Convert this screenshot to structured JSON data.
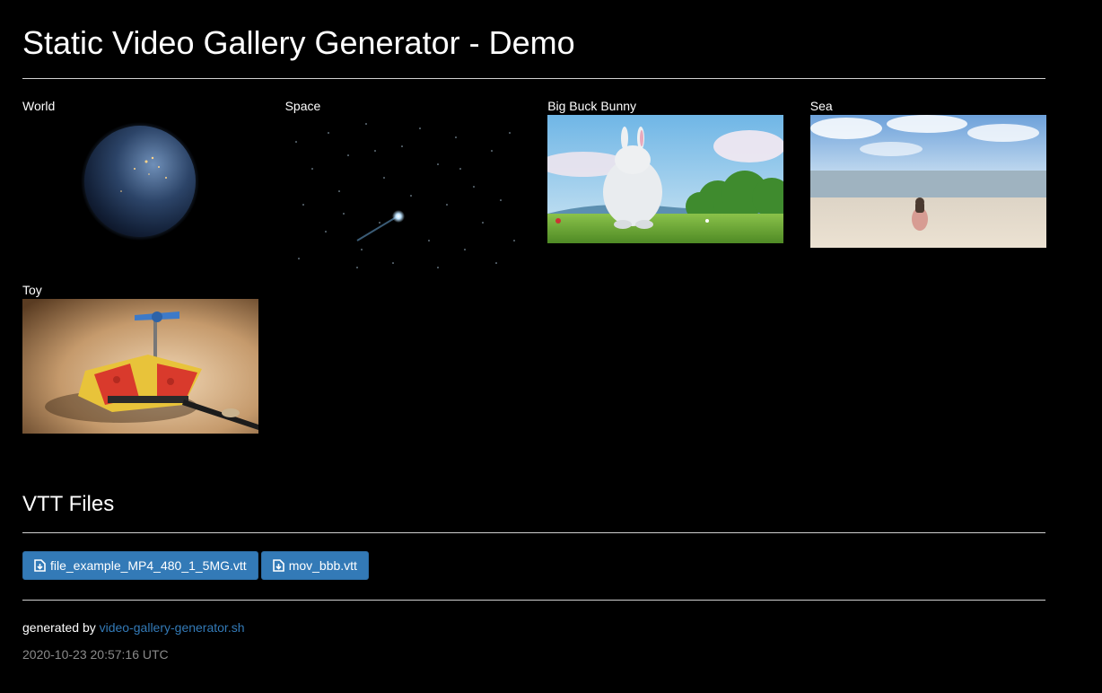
{
  "page": {
    "title": "Static Video Gallery Generator - Demo"
  },
  "gallery": {
    "items": [
      {
        "label": "World"
      },
      {
        "label": "Space"
      },
      {
        "label": "Big Buck Bunny"
      },
      {
        "label": "Sea"
      },
      {
        "label": "Toy"
      }
    ]
  },
  "vtt": {
    "heading": "VTT Files",
    "files": [
      {
        "label": "file_example_MP4_480_1_5MG.vtt",
        "icon": "file-download-icon"
      },
      {
        "label": "mov_bbb.vtt",
        "icon": "file-download-icon"
      }
    ]
  },
  "footer": {
    "prefix": "generated by",
    "link_text": "video-gallery-generator.sh",
    "timestamp": "2020-10-23 20:57:16 UTC"
  },
  "colors": {
    "background": "#000000",
    "button": "#337ab7",
    "link": "#337ab7",
    "timestamp": "#8a8a8a"
  }
}
